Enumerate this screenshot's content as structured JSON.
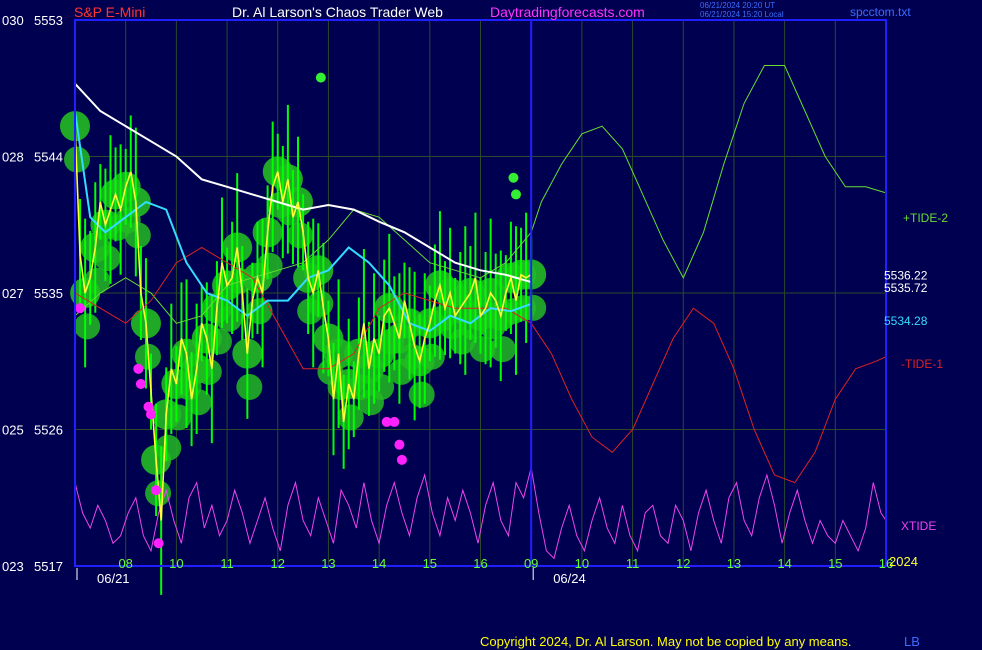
{
  "header": {
    "symbol": "S&P E-Mini",
    "title": "Dr. Al Larson's Chaos Trader Web",
    "site": "Daytradingforecasts.com",
    "ut_stamp": "06/21/2024 20:20 UT",
    "local_stamp": "06/21/2024 15:20 Local",
    "file": "spcctom.txt"
  },
  "footer": {
    "copyright": "Copyright 2024, Dr. Al Larson. May not be copied by any means.",
    "initials": "LB"
  },
  "colors": {
    "background": "#000050",
    "grid": "#2a4a2a",
    "frame": "#2020ff",
    "price_bar": "#00ff00",
    "halo": "#22bb22",
    "ma_white": "#ffffff",
    "ma_cyan": "#33ddff",
    "ma_yellow": "#ffff33",
    "magenta": "#ff22ff",
    "tide2": "#66dd33",
    "tide1": "#dd2222",
    "xtide": "#ee44ee",
    "axis_text": "#66ff33",
    "price_text": "#ffffff"
  },
  "chart_data": {
    "type": "line",
    "y_axis": {
      "ticks": [
        {
          "left": "030",
          "right": "5553",
          "value": 5553
        },
        {
          "left": "028",
          "right": "5544",
          "value": 5544
        },
        {
          "left": "027",
          "right": "5535",
          "value": 5535
        },
        {
          "left": "025",
          "right": "5526",
          "value": 5526
        },
        {
          "left": "023",
          "right": "5517",
          "value": 5517
        }
      ],
      "ylim": [
        5517,
        5553
      ]
    },
    "x_axis": {
      "hour_labels": [
        "08",
        "10",
        "11",
        "12",
        "13",
        "14",
        "15",
        "16",
        "09",
        "10",
        "11",
        "12",
        "13",
        "14",
        "15",
        "16"
      ],
      "date_labels": [
        "06/21",
        "06/24"
      ],
      "year_label": "2024",
      "xlim": [
        7,
        23
      ]
    },
    "price_labels": [
      {
        "text": "5536.22",
        "value": 5536.22,
        "color": "#ffffff"
      },
      {
        "text": "5535.72",
        "value": 5535.72,
        "color": "#ffffff"
      },
      {
        "text": "5534.28",
        "value": 5534.28,
        "color": "#33ddff"
      }
    ],
    "line_labels": [
      {
        "text": "+TIDE-2",
        "color": "#66dd33"
      },
      {
        "text": "-TIDE-1",
        "color": "#dd2222"
      },
      {
        "text": "XTIDE",
        "color": "#ee44ee"
      }
    ],
    "series": [
      {
        "key": "price_close",
        "color": "#ffff33",
        "x": [
          7.0,
          7.1,
          7.2,
          7.3,
          7.4,
          7.5,
          7.6,
          7.7,
          7.8,
          7.9,
          8.0,
          8.1,
          8.2,
          8.3,
          8.4,
          8.5,
          8.6,
          8.7,
          8.8,
          8.9,
          9.0,
          9.1,
          9.2,
          9.3,
          9.4,
          9.5,
          9.6,
          9.7,
          9.8,
          9.9,
          10.0,
          10.1,
          10.2,
          10.3,
          10.4,
          10.5,
          10.6,
          10.7,
          10.8,
          10.9,
          11.0,
          11.1,
          11.2,
          11.3,
          11.4,
          11.5,
          11.6,
          11.7,
          11.8,
          11.9,
          12.0,
          12.1,
          12.2,
          12.3,
          12.4,
          12.5,
          12.6,
          12.7,
          12.8,
          12.9,
          13.0,
          13.1,
          13.2,
          13.3,
          13.4,
          13.5,
          13.6,
          13.7,
          13.8,
          13.9,
          14.0,
          14.1,
          14.2,
          14.3,
          14.4,
          14.5,
          14.6,
          14.7,
          14.8,
          14.9,
          15.0,
          15.1,
          15.2,
          15.3,
          15.4,
          15.5,
          15.6,
          15.7,
          15.8,
          15.9,
          16.0
        ],
        "y": [
          5546.0,
          5537.5,
          5535.0,
          5536.0,
          5538.0,
          5541.0,
          5539.5,
          5540.5,
          5541.5,
          5540.5,
          5542.0,
          5543.0,
          5541.0,
          5535.0,
          5533.0,
          5528.5,
          5524.0,
          5520.0,
          5527.0,
          5530.0,
          5529.0,
          5532.0,
          5531.0,
          5528.0,
          5530.0,
          5533.0,
          5532.0,
          5530.0,
          5534.0,
          5537.0,
          5535.5,
          5536.0,
          5538.0,
          5535.0,
          5531.0,
          5534.5,
          5536.0,
          5535.0,
          5539.0,
          5542.0,
          5543.0,
          5541.0,
          5542.5,
          5540.0,
          5541.0,
          5539.0,
          5536.0,
          5535.0,
          5536.5,
          5534.0,
          5532.0,
          5528.0,
          5531.0,
          5526.5,
          5529.0,
          5528.0,
          5531.0,
          5533.0,
          5530.0,
          5532.0,
          5531.0,
          5533.5,
          5534.0,
          5533.0,
          5532.0,
          5534.5,
          5533.0,
          5531.5,
          5530.5,
          5532.0,
          5533.0,
          5534.5,
          5535.5,
          5534.0,
          5535.0,
          5533.5,
          5534.0,
          5534.5,
          5535.0,
          5536.0,
          5533.5,
          5534.0,
          5535.0,
          5534.5,
          5533.5,
          5535.0,
          5536.0,
          5534.5,
          5536.2,
          5536.0,
          5536.22
        ]
      },
      {
        "key": "ma_white",
        "color": "#ffffff",
        "x": [
          7.0,
          7.5,
          8.0,
          8.5,
          9.0,
          9.5,
          10.0,
          10.5,
          11.0,
          11.5,
          12.0,
          12.5,
          13.0,
          13.5,
          14.0,
          14.5,
          15.0,
          15.5,
          16.0
        ],
        "y": [
          5548.8,
          5547.0,
          5546.0,
          5545.0,
          5544.0,
          5542.5,
          5542.0,
          5541.5,
          5541.0,
          5540.5,
          5540.8,
          5540.5,
          5539.7,
          5539.0,
          5538.0,
          5537.0,
          5536.5,
          5536.2,
          5535.72
        ]
      },
      {
        "key": "ma_cyan",
        "color": "#33ddff",
        "x": [
          7.0,
          7.3,
          7.6,
          8.0,
          8.4,
          8.8,
          9.2,
          9.6,
          10.0,
          10.4,
          10.8,
          11.2,
          11.6,
          12.0,
          12.4,
          12.8,
          13.2,
          13.6,
          14.0,
          14.4,
          14.8,
          15.2,
          15.6,
          16.0
        ],
        "y": [
          5547.0,
          5540.0,
          5539.0,
          5540.0,
          5541.0,
          5540.5,
          5537.0,
          5535.0,
          5534.5,
          5533.5,
          5534.5,
          5534.5,
          5536.0,
          5536.5,
          5538.0,
          5537.0,
          5535.5,
          5533.0,
          5532.5,
          5533.5,
          5533.0,
          5534.0,
          5533.8,
          5534.28
        ]
      },
      {
        "key": "tide2",
        "color": "#66dd33",
        "x": [
          7.0,
          7.5,
          8.0,
          8.5,
          9.0,
          9.5,
          10.0,
          10.5,
          11.0,
          11.5,
          12.0,
          12.5,
          13.0,
          13.5,
          14.0,
          14.5,
          15.0,
          15.5,
          16.0,
          16.2,
          16.6,
          17.0,
          17.4,
          17.8,
          18.2,
          18.6,
          19.0,
          19.4,
          19.8,
          20.2,
          20.6,
          21.0,
          21.4,
          21.8,
          22.2,
          22.6,
          23.0
        ],
        "y": [
          5533.5,
          5535.0,
          5536.0,
          5535.0,
          5533.0,
          5533.5,
          5535.5,
          5536.0,
          5536.5,
          5537.0,
          5538.5,
          5540.5,
          5540.0,
          5538.5,
          5537.0,
          5536.5,
          5536.0,
          5537.0,
          5539.0,
          5541.0,
          5543.5,
          5545.5,
          5546.0,
          5544.5,
          5541.5,
          5538.5,
          5536.0,
          5539.0,
          5543.5,
          5547.5,
          5550.0,
          5550.0,
          5547.0,
          5544.0,
          5542.0,
          5542.0,
          5541.6
        ]
      },
      {
        "key": "tide1",
        "color": "#dd2222",
        "x": [
          7.0,
          7.5,
          8.0,
          8.5,
          9.0,
          9.5,
          10.0,
          10.5,
          11.0,
          11.5,
          12.0,
          12.5,
          13.0,
          13.5,
          14.0,
          14.5,
          15.0,
          15.5,
          16.0,
          16.4,
          16.8,
          17.2,
          17.6,
          18.0,
          18.4,
          18.8,
          19.2,
          19.6,
          20.0,
          20.4,
          20.8,
          21.2,
          21.6,
          22.0,
          22.4,
          22.8,
          23.0
        ],
        "y": [
          5535.0,
          5534.0,
          5533.0,
          5534.5,
          5537.0,
          5538.0,
          5537.0,
          5536.0,
          5533.0,
          5530.0,
          5530.0,
          5531.0,
          5534.0,
          5535.0,
          5534.5,
          5534.0,
          5534.0,
          5534.0,
          5533.0,
          5531.0,
          5528.0,
          5525.5,
          5524.5,
          5526.0,
          5529.0,
          5532.0,
          5534.0,
          5533.0,
          5530.0,
          5526.0,
          5523.0,
          5522.5,
          5524.5,
          5528.0,
          5530.0,
          5530.5,
          5530.8
        ]
      },
      {
        "key": "xtide",
        "color": "#ee44ee",
        "x": [
          7.0,
          7.15,
          7.3,
          7.45,
          7.6,
          7.75,
          7.9,
          8.05,
          8.2,
          8.35,
          8.5,
          8.65,
          8.8,
          8.95,
          9.1,
          9.25,
          9.4,
          9.55,
          9.7,
          9.85,
          10.0,
          10.15,
          10.3,
          10.45,
          10.6,
          10.75,
          10.9,
          11.05,
          11.2,
          11.35,
          11.5,
          11.65,
          11.8,
          11.95,
          12.1,
          12.25,
          12.4,
          12.55,
          12.7,
          12.85,
          13.0,
          13.15,
          13.3,
          13.45,
          13.6,
          13.75,
          13.9,
          14.05,
          14.2,
          14.35,
          14.5,
          14.65,
          14.8,
          14.95,
          15.1,
          15.25,
          15.4,
          15.55,
          15.7,
          15.85,
          16.0,
          16.15,
          16.3,
          16.45,
          16.6,
          16.75,
          16.9,
          17.05,
          17.2,
          17.35,
          17.5,
          17.65,
          17.8,
          17.95,
          18.1,
          18.25,
          18.4,
          18.55,
          18.7,
          18.85,
          19.0,
          19.15,
          19.3,
          19.45,
          19.6,
          19.75,
          19.9,
          20.05,
          20.2,
          20.35,
          20.5,
          20.65,
          20.8,
          20.95,
          21.1,
          21.25,
          21.4,
          21.55,
          21.7,
          21.85,
          22.0,
          22.15,
          22.3,
          22.45,
          22.6,
          22.75,
          22.9,
          23.0
        ],
        "y": [
          5522.5,
          5520.5,
          5519.5,
          5521.0,
          5520.0,
          5518.5,
          5519.0,
          5520.5,
          5521.5,
          5519.0,
          5518.0,
          5520.5,
          5522.0,
          5520.0,
          5518.5,
          5521.5,
          5522.5,
          5519.5,
          5521.0,
          5519.0,
          5520.0,
          5522.0,
          5520.5,
          5518.5,
          5520.0,
          5521.5,
          5519.5,
          5518.0,
          5521.0,
          5522.5,
          5520.0,
          5519.0,
          5521.5,
          5520.0,
          5518.5,
          5522.0,
          5521.0,
          5519.5,
          5522.5,
          5520.0,
          5518.5,
          5521.0,
          5522.5,
          5520.5,
          5519.0,
          5521.5,
          5523.0,
          5520.5,
          5519.0,
          5521.5,
          5520.0,
          5522.0,
          5520.5,
          5518.5,
          5521.0,
          5522.5,
          5520.0,
          5519.0,
          5522.5,
          5521.5,
          5523.5,
          5520.5,
          5518.0,
          5517.5,
          5519.5,
          5521.0,
          5519.0,
          5518.0,
          5520.0,
          5521.5,
          5519.5,
          5518.5,
          5521.0,
          5519.0,
          5518.0,
          5520.5,
          5521.0,
          5519.0,
          5518.5,
          5521.0,
          5520.0,
          5518.0,
          5520.5,
          5522.0,
          5520.0,
          5518.5,
          5521.5,
          5522.5,
          5520.0,
          5519.0,
          5521.5,
          5523.0,
          5521.0,
          5518.5,
          5520.5,
          5522.0,
          5520.0,
          5518.5,
          5520.0,
          5519.0,
          5518.5,
          5520.0,
          5519.0,
          5518.0,
          5519.5,
          5522.5,
          5520.5,
          5520.0
        ]
      }
    ]
  }
}
